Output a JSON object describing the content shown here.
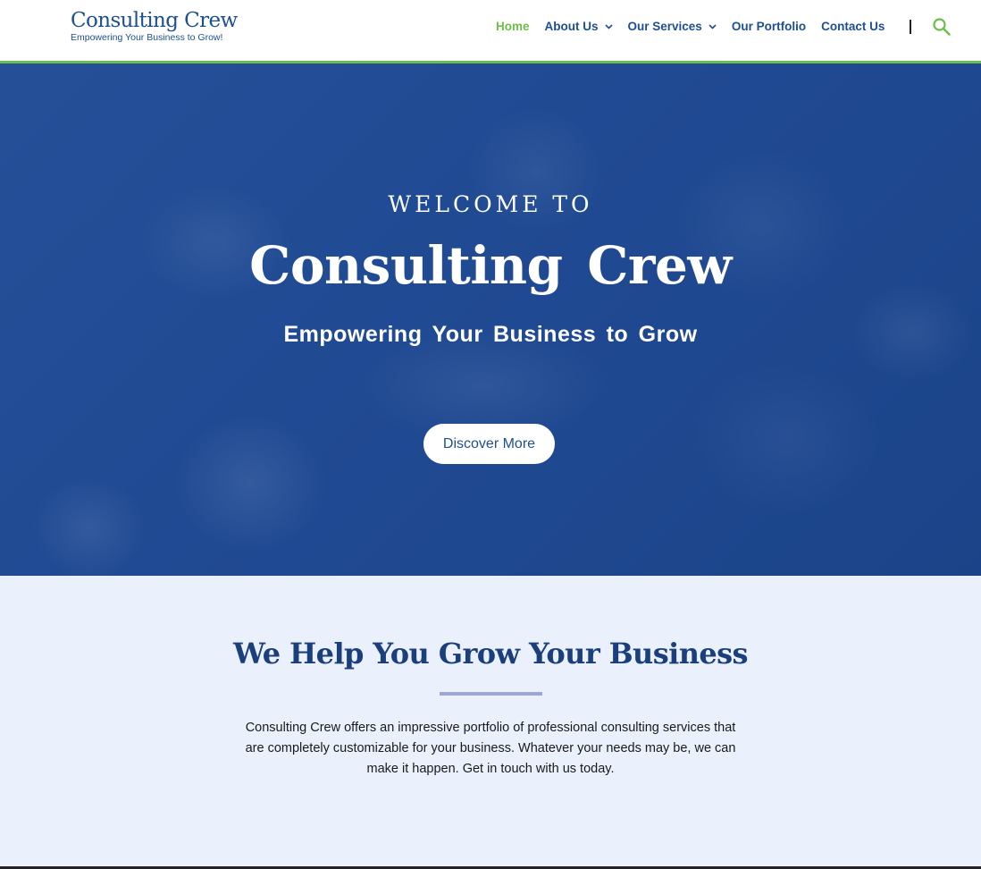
{
  "brand": {
    "name": "Consulting Crew",
    "tagline": "Empowering Your Business to Grow!"
  },
  "nav": {
    "items": [
      {
        "label": "Home",
        "active": true
      },
      {
        "label": "About Us",
        "dropdown": true
      },
      {
        "label": "Our Services",
        "dropdown": true
      },
      {
        "label": "Our Portfolio"
      },
      {
        "label": "Contact Us"
      }
    ],
    "search_icon": "search-icon"
  },
  "hero": {
    "welcome": "WELCOME TO",
    "title": "Consulting Crew",
    "subtitle": "Empowering Your Business to Grow",
    "button_label": "Discover More"
  },
  "intro": {
    "title": "We Help You Grow Your Business",
    "text": "Consulting Crew offers an impressive portfolio of professional consulting services that are completely customizable for your business. Whatever your needs may be, we can make it happen. Get in touch with us today."
  },
  "colors": {
    "brand_blue": "#1d4f91",
    "accent_green": "#6cc04a",
    "hero_blue": "#24509a",
    "page_bg": "#eaf1fc"
  }
}
